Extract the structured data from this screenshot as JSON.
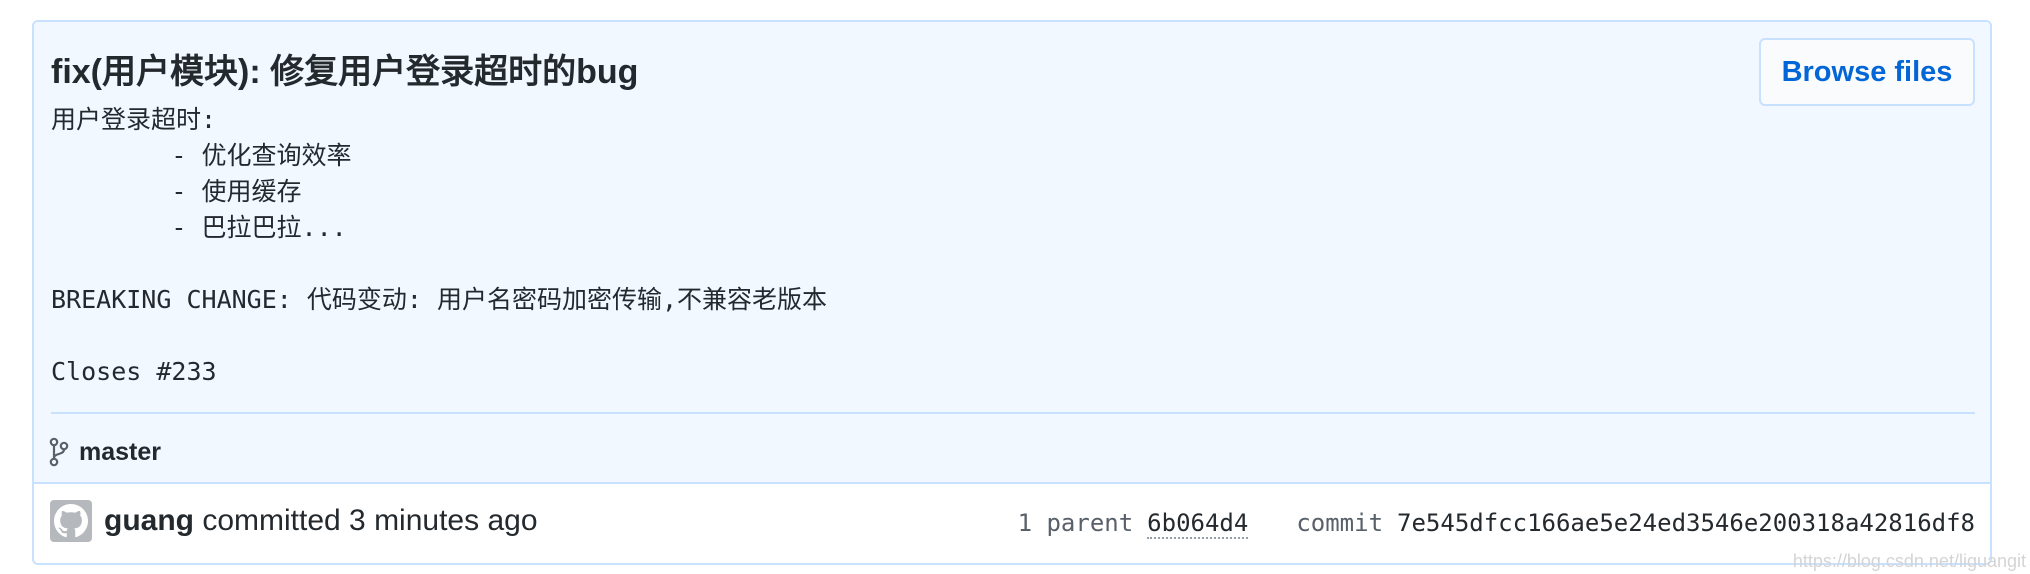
{
  "commit": {
    "title": "fix(用户模块): 修复用户登录超时的bug",
    "description": "用户登录超时:\n        - 优化查询效率\n        - 使用缓存\n        - 巴拉巴拉...\n\nBREAKING CHANGE: 代码变动: 用户名密码加密传输,不兼容老版本\n\nCloses #233",
    "browse_button_label": "Browse files",
    "branch": "master",
    "branch_icon": "git-branch-icon",
    "author": "guang",
    "action_text": "committed 3 minutes ago",
    "parent_count_label": "1 parent",
    "parent_sha": "6b064d4",
    "commit_label": "commit",
    "commit_sha": "7e545dfcc166ae5e24ed3546e200318a42816df8"
  },
  "watermark": "https://blog.csdn.net/liguangit",
  "colors": {
    "header_bg": "#f1f8ff",
    "border": "#c8e1ff",
    "link_blue": "#0366d6",
    "text": "#24292e",
    "muted": "#586069"
  }
}
